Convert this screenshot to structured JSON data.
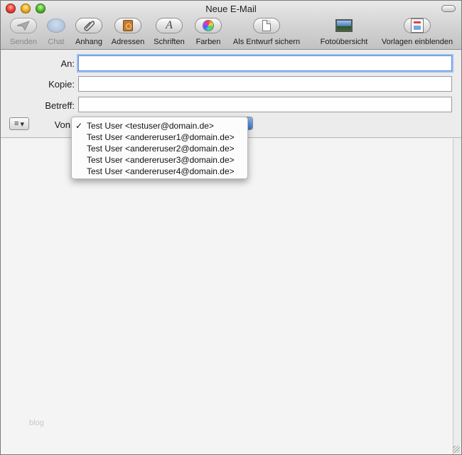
{
  "window": {
    "title": "Neue E-Mail"
  },
  "toolbar": {
    "items": [
      {
        "label": "Senden",
        "icon": "send-icon",
        "enabled": false
      },
      {
        "label": "Chat",
        "icon": "chat-icon",
        "enabled": false
      },
      {
        "label": "Anhang",
        "icon": "paperclip-icon",
        "enabled": true
      },
      {
        "label": "Adressen",
        "icon": "address-book-icon",
        "enabled": true
      },
      {
        "label": "Schriften",
        "icon": "fonts-icon",
        "enabled": true
      },
      {
        "label": "Farben",
        "icon": "color-wheel-icon",
        "enabled": true
      },
      {
        "label": "Als Entwurf sichern",
        "icon": "draft-icon",
        "enabled": true
      },
      {
        "label": "Fotoübersicht",
        "icon": "photo-browser-icon",
        "enabled": true
      },
      {
        "label": "Vorlagen einblenden",
        "icon": "stationery-icon",
        "enabled": true
      }
    ]
  },
  "headers": {
    "to_label": "An:",
    "to_value": "",
    "cc_label": "Kopie:",
    "cc_value": "",
    "subject_label": "Betreff:",
    "subject_value": "",
    "from_label": "Von"
  },
  "from_menu": {
    "selected_index": 0,
    "check_glyph": "✓",
    "options": [
      "Test User <testuser@domain.de>",
      "Test User <andereruser1@domain.de>",
      "Test User <andereruser2@domain.de>",
      "Test User <andereruser3@domain.de>",
      "Test User <andereruser4@domain.de>"
    ]
  },
  "body": {
    "watermark": "blog"
  }
}
